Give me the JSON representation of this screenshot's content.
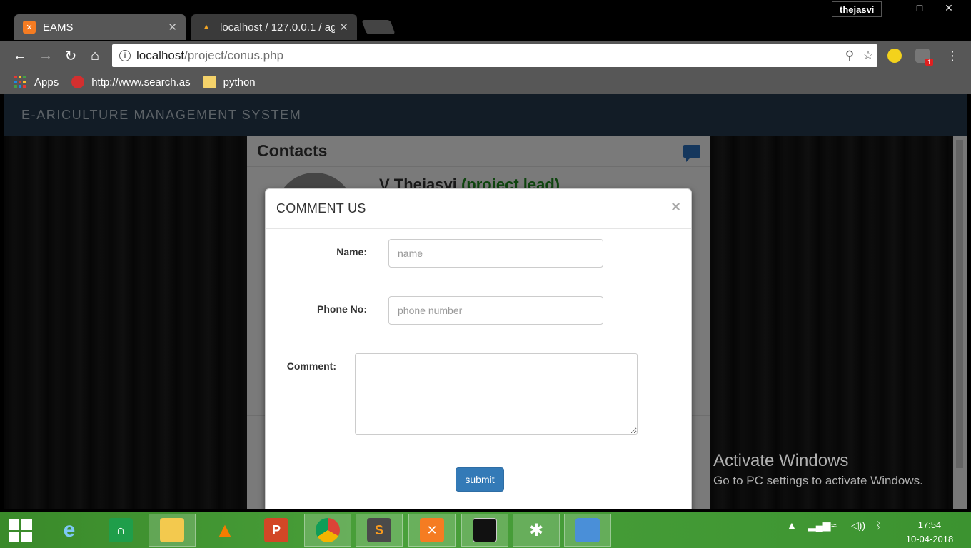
{
  "browser": {
    "tabs": [
      {
        "title": "EAMS",
        "icon": "xampp-icon",
        "active": true
      },
      {
        "title": "localhost / 127.0.0.1 / ag",
        "icon": "phpmyadmin-icon",
        "active": false
      }
    ],
    "profile_name": "thejasvi",
    "window_controls": {
      "minimize": "–",
      "maximize": "□",
      "close": "✕"
    },
    "url_host": "localhost",
    "url_path": "/project/conus.php",
    "extension_badge": "1",
    "bookmarks": [
      {
        "label": "Apps",
        "icon": "apps-grid-icon"
      },
      {
        "label": "http://www.search.as",
        "icon": "ask-icon"
      },
      {
        "label": "python",
        "icon": "folder-icon"
      }
    ]
  },
  "page": {
    "brand": "E-ARICULTURE MANAGEMENT SYSTEM",
    "panel_title": "Contacts",
    "person_name": "V Thejasvi",
    "person_role": "(project lead)"
  },
  "modal": {
    "title": "COMMENT US",
    "close": "×",
    "name_label": "Name:",
    "name_placeholder": "name",
    "phone_label": "Phone No:",
    "phone_placeholder": "phone number",
    "comment_label": "Comment:",
    "submit_label": "submit"
  },
  "watermark": {
    "title": "Activate Windows",
    "subtitle": "Go to PC settings to activate Windows."
  },
  "taskbar": {
    "apps": [
      "internet-explorer-icon",
      "headset-app-icon",
      "file-explorer-icon",
      "vlc-icon",
      "powerpoint-icon",
      "chrome-icon",
      "sublime-text-icon",
      "xampp-icon",
      "command-prompt-icon",
      "spider-app-icon",
      "photos-icon"
    ],
    "time": "17:54",
    "date": "10-04-2018"
  },
  "colors": {
    "navbar": "#24384c",
    "primary_button": "#337ab7",
    "taskbar": "#49a03a",
    "role_text": "#1e8a1e"
  }
}
